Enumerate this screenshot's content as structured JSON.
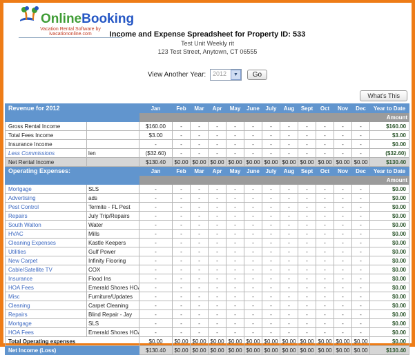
{
  "logo": {
    "name_online": "Online",
    "name_booking": "Booking",
    "tagline": "Vacation Rental Software by ivacationonline.com"
  },
  "header": {
    "title": "Income and Expense Spreadsheet for Property ID: 533",
    "unit": "Test Unit Weekly rit",
    "address": "123 Test Street, Anytown, CT 06555"
  },
  "year_selector": {
    "label": "View Another Year:",
    "selected_year": "2012",
    "go_label": "Go"
  },
  "whats_this_label": "What's This",
  "table": {
    "ytd_label": "Year to Date",
    "amount_label": "Amount",
    "dash": "-",
    "months": [
      "Jan",
      "Feb",
      "Mar",
      "Apr",
      "May",
      "June",
      "July",
      "Aug",
      "Sept",
      "Oct",
      "Nov",
      "Dec"
    ],
    "revenue": {
      "title": "Revenue for 2012",
      "rows": [
        {
          "label": "Gross Rental Income",
          "desc": "",
          "months": [
            "$160.00",
            "-",
            "-",
            "-",
            "-",
            "-",
            "-",
            "-",
            "-",
            "-",
            "-",
            "-"
          ],
          "ytd": "$160.00",
          "style": "plain"
        },
        {
          "label": "Total Fees Income",
          "desc": "",
          "months": [
            "$3.00",
            "-",
            "-",
            "-",
            "-",
            "-",
            "-",
            "-",
            "-",
            "-",
            "-",
            "-"
          ],
          "ytd": "$3.00",
          "style": "plain"
        },
        {
          "label": "Insurance Income",
          "desc": "",
          "months": [
            "-",
            "-",
            "-",
            "-",
            "-",
            "-",
            "-",
            "-",
            "-",
            "-",
            "-",
            "-"
          ],
          "ytd": "$0.00",
          "style": "plain"
        },
        {
          "label": "Less Commissions",
          "desc": "len",
          "months": [
            "($32.60)",
            "-",
            "-",
            "-",
            "-",
            "-",
            "-",
            "-",
            "-",
            "-",
            "-",
            "-"
          ],
          "ytd": "($32.60)",
          "style": "link-italic"
        },
        {
          "label": "Net Rental Income",
          "desc": "",
          "months": [
            "$130.40",
            "$0.00",
            "$0.00",
            "$0.00",
            "$0.00",
            "$0.00",
            "$0.00",
            "$0.00",
            "$0.00",
            "$0.00",
            "$0.00",
            "$0.00"
          ],
          "ytd": "$130.40",
          "style": "shaded"
        }
      ]
    },
    "expenses": {
      "title": "Operating Expenses:",
      "row_ytd": "$0.00",
      "rows": [
        {
          "label": "Mortgage",
          "desc": "SLS"
        },
        {
          "label": "Advertising",
          "desc": "ads"
        },
        {
          "label": "Pest Control",
          "desc": "Termite - FL Pest"
        },
        {
          "label": "Repairs",
          "desc": "July Trip/Repairs"
        },
        {
          "label": "South Walton",
          "desc": "Water"
        },
        {
          "label": "HVAC",
          "desc": "Mills"
        },
        {
          "label": "Cleaning Expenses",
          "desc": "Kastle Keepers"
        },
        {
          "label": "Utilities",
          "desc": "Gulf Power"
        },
        {
          "label": "New Carpet",
          "desc": "Infinity Flooring"
        },
        {
          "label": "Cable/Satellite TV",
          "desc": "COX"
        },
        {
          "label": "Insurance",
          "desc": "Flood Ins"
        },
        {
          "label": "HOA Fees",
          "desc": "Emerald Shores HOA"
        },
        {
          "label": "Misc",
          "desc": "Furniture/Updates"
        },
        {
          "label": "Cleaning",
          "desc": "Carpet Cleaning"
        },
        {
          "label": "Repairs",
          "desc": "Blind Repair - Jay"
        },
        {
          "label": "Mortgage",
          "desc": "SLS"
        },
        {
          "label": "HOA Fees",
          "desc": "Emerald Shores HOA"
        }
      ]
    },
    "total_row": {
      "label": "Total Operating expenses",
      "months": [
        "$0.00",
        "$0.00",
        "$0.00",
        "$0.00",
        "$0.00",
        "$0.00",
        "$0.00",
        "$0.00",
        "$0.00",
        "$0.00",
        "$0.00",
        "$0.00"
      ],
      "ytd": "$0.00"
    },
    "net_row": {
      "label": "Net Income (Loss)",
      "months": [
        "$130.40",
        "$0.00",
        "$0.00",
        "$0.00",
        "$0.00",
        "$0.00",
        "$0.00",
        "$0.00",
        "$0.00",
        "$0.00",
        "$0.00",
        "$0.00"
      ],
      "ytd": "$130.40"
    }
  },
  "colors": {
    "frame_orange": "#ee7c16",
    "header_blue": "#6195ce",
    "band_gray": "#9b9b9b",
    "link_blue": "#3a67c0",
    "money_green": "#2d572d"
  }
}
